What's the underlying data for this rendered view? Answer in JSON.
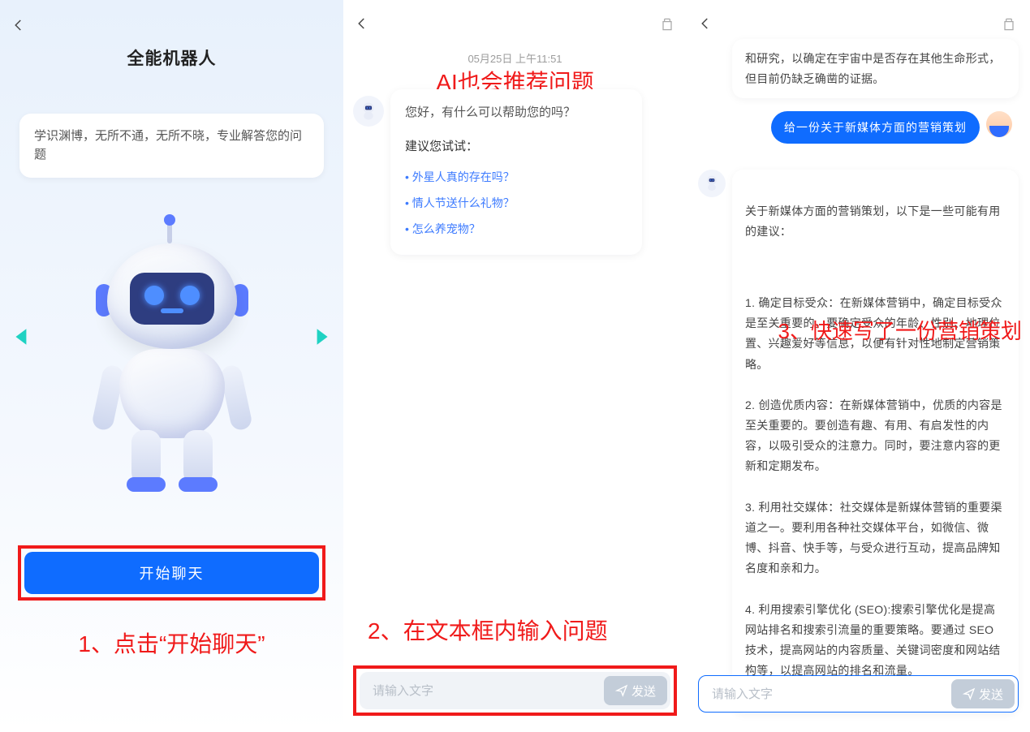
{
  "pane1": {
    "title": "全能机器人",
    "desc": "学识渊博，无所不通，无所不晓，专业解答您的问题",
    "start_label": "开始聊天",
    "annotation": "1、点击“开始聊天”"
  },
  "pane2": {
    "timestamp": "05月25日  上午11:51",
    "annotation_top": "AI也会推荐问题",
    "greeting": "您好，有什么可以帮助您的吗？",
    "try_label": "建议您试试：",
    "suggestions": [
      "外星人真的存在吗？",
      "情人节送什么礼物？",
      "怎么养宠物？"
    ],
    "annotation_mid": "2、在文本框内输入问题",
    "input_placeholder": "请输入文字",
    "send_label": "发送"
  },
  "pane3": {
    "prev_bot_tail": "和研究，以确定在宇宙中是否存在其他生命形式，但目前仍缺乏确凿的证据。",
    "user_msg": "给一份关于新媒体方面的营销策划",
    "bot_intro": "关于新媒体方面的营销策划，以下是一些可能有用的建议：",
    "bot_body": "1. 确定目标受众：在新媒体营销中，确定目标受众是至关重要的。要确定受众的年龄、性别、地理位置、兴趣爱好等信息，以便有针对性地制定营销策略。\n\n2. 创造优质内容：在新媒体营销中，优质的内容是至关重要的。要创造有趣、有用、有启发性的内容，以吸引受众的注意力。同时，要注意内容的更新和定期发布。\n\n3. 利用社交媒体：社交媒体是新媒体营销的重要渠道之一。要利用各种社交媒体平台，如微信、微博、抖音、快手等，与受众进行互动，提高品牌知名度和亲和力。\n\n4. 利用搜索引擎优化 (SEO):搜索引擎优化是提高网站排名和搜索引流量的重要策略。要通过 SEO 技术，提高网站的内容质量、关键词密度和网站结构等，以提高网站的排名和流量。",
    "annotation": "3、快速写了一份营销策划",
    "input_placeholder": "请输入文字",
    "send_label": "发送"
  }
}
